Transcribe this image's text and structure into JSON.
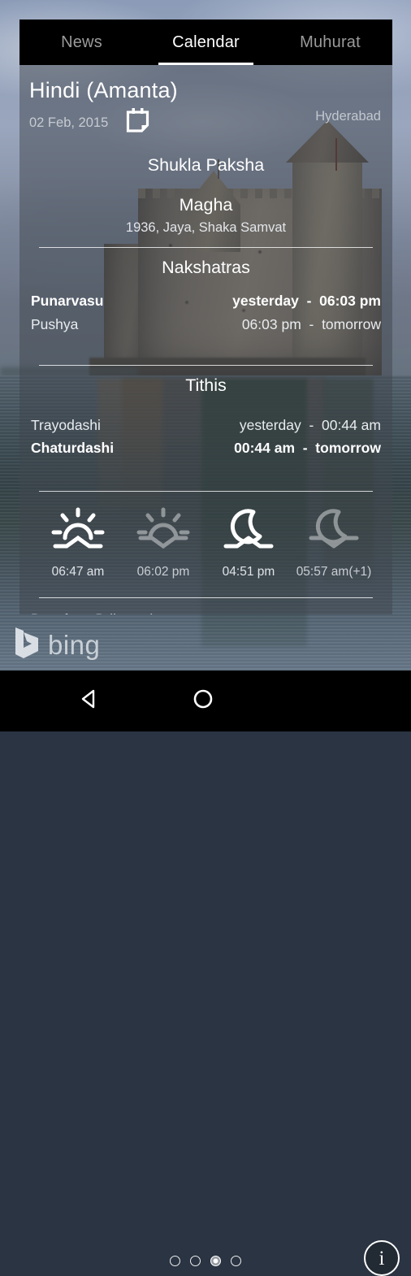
{
  "tabs": [
    {
      "label": "News",
      "active": false
    },
    {
      "label": "Calendar",
      "active": true
    },
    {
      "label": "Muhurat",
      "active": false
    }
  ],
  "header": {
    "title": "Hindi (Amanta)",
    "date": "02 Feb, 2015",
    "calendar_icon": "calendar-icon",
    "city": "Hyderabad"
  },
  "panchang": {
    "paksha": "Shukla Paksha",
    "month": "Magha",
    "samvat": "1936, Jaya, Shaka Samvat"
  },
  "nakshatras": {
    "heading": "Nakshatras",
    "rows": [
      {
        "name": "Punarvasu",
        "time": "yesterday  -  06:03 pm",
        "highlight": true
      },
      {
        "name": "Pushya",
        "time": "06:03 pm  -  tomorrow",
        "highlight": false
      }
    ]
  },
  "tithis": {
    "heading": "Tithis",
    "rows": [
      {
        "name": "Trayodashi",
        "time": "yesterday  -  00:44 am",
        "highlight": false
      },
      {
        "name": "Chaturdashi",
        "time": "00:44 am  -  tomorrow",
        "highlight": true
      }
    ]
  },
  "astro": [
    {
      "icon": "sunrise-icon",
      "time": "06:47 am",
      "dim": false
    },
    {
      "icon": "sunset-icon",
      "time": "06:02 pm",
      "dim": true
    },
    {
      "icon": "moonrise-icon",
      "time": "04:51 pm",
      "dim": false
    },
    {
      "icon": "moonset-icon",
      "time": "05:57 am(+1)",
      "dim": true
    }
  ],
  "source_text": "Data from Drikpanchang",
  "footer": {
    "brand": "bing",
    "brand_icon": "bing-logo-icon",
    "info_label": "i",
    "pager": {
      "total": 4,
      "current": 3
    }
  },
  "navbar": {
    "back_icon": "back-triangle-icon",
    "home_icon": "home-circle-icon"
  },
  "colors": {
    "tabbar_bg": "#000000",
    "accent_underline": "#ffffff",
    "card_overlay": "rgba(64,70,78,0.50)",
    "primary_text": "#ffffff",
    "muted_text": "#c6cbd2"
  }
}
